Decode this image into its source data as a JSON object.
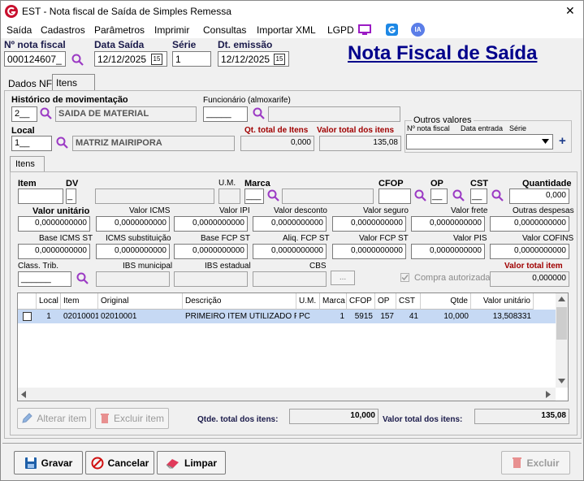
{
  "window": {
    "title": "EST - Nota fiscal de Saída de Simples Remessa",
    "close_glyph": "✕"
  },
  "menu": [
    "Saída",
    "Cadastros",
    "Parâmetros",
    "Imprimir",
    "Consultas",
    "Importar XML",
    "LGPD"
  ],
  "menu_ia": "IA",
  "header": {
    "nota_label": "Nº nota fiscal",
    "nota_value": "000124607_",
    "data_saida_label": "Data Saída",
    "data_saida_value": "12/12/2025",
    "serie_label": "Série",
    "serie_value": "1",
    "dt_emissao_label": "Dt. emissão",
    "dt_emissao_value": "12/12/2025",
    "big_title": "Nota Fiscal de Saída",
    "cal_glyph": "15"
  },
  "tabs": {
    "dados": "Dados NF",
    "itens": "Itens NF"
  },
  "form": {
    "historico_label": "Histórico de movimentação",
    "historico_code": "2__",
    "historico_desc": "SAIDA DE MATERIAL",
    "funcionario_label": "Funcionário (almoxarife)",
    "funcionario_value": "_____",
    "local_label": "Local",
    "local_code": "1__",
    "local_desc": "MATRIZ MAIRIPORA",
    "qt_total_label": "Qt. total de Itens",
    "qt_total_value": "0,000",
    "valor_total_label": "Valor total dos itens",
    "valor_total_value": "135,08",
    "outros_label": "Outros valores",
    "outros_cols": [
      "Nº nota fiscal",
      "Data entrada",
      "Série"
    ],
    "plus": "+"
  },
  "inner_tab": "Itens",
  "item": {
    "item_label": "Item",
    "dv_label": "DV",
    "dv_value": "_",
    "um_label": "U.M.",
    "marca_label": "Marca",
    "marca_value": "___",
    "cfop_label": "CFOP",
    "op_label": "OP",
    "op_value": "__",
    "cst_label": "CST",
    "cst_value": "__",
    "quantidade_label": "Quantidade",
    "quantidade_value": "0,000",
    "row2": [
      {
        "label": "Valor unitário",
        "value": "0,0000000000"
      },
      {
        "label": "Valor ICMS",
        "value": "0,0000000000"
      },
      {
        "label": "Valor IPI",
        "value": "0,0000000000"
      },
      {
        "label": "Valor desconto",
        "value": "0,0000000000"
      },
      {
        "label": "Valor seguro",
        "value": "0,0000000000"
      },
      {
        "label": "Valor frete",
        "value": "0,0000000000"
      },
      {
        "label": "Outras despesas",
        "value": "0,0000000000"
      }
    ],
    "row3": [
      {
        "label": "Base ICMS ST",
        "value": "0,0000000000"
      },
      {
        "label": "ICMS substituição",
        "value": "0,0000000000"
      },
      {
        "label": "Base FCP ST",
        "value": "0,0000000000"
      },
      {
        "label": "Aliq. FCP ST",
        "value": "0,0000000000"
      },
      {
        "label": "Valor FCP ST",
        "value": "0,0000000000"
      },
      {
        "label": "Valor PIS",
        "value": "0,0000000000"
      },
      {
        "label": "Valor COFINS",
        "value": "0,0000000000"
      }
    ],
    "class_trib_label": "Class. Trib.",
    "class_trib_value": "______",
    "ibs_mun_label": "IBS municipal",
    "ibs_est_label": "IBS estadual",
    "cbs_label": "CBS",
    "ellipsis": "...",
    "compra_label": "Compra autorizada",
    "valor_total_item_label": "Valor total item",
    "valor_total_item_value": "0,000000"
  },
  "grid": {
    "columns": [
      "Local",
      "Item",
      "Original",
      "Descrição",
      "U.M.",
      "Marca",
      "CFOP",
      "OP",
      "CST",
      "Qtde",
      "Valor unitário"
    ],
    "row": [
      "1",
      "02010001",
      "02010001",
      "PRIMEIRO ITEM UTILIZADO P...",
      "PC",
      "1",
      "5915",
      "157",
      "41",
      "10,000",
      "13,508331"
    ]
  },
  "bottom": {
    "alterar": "Alterar item",
    "excluir_item": "Excluir item",
    "qtde_total_label": "Qtde. total dos itens:",
    "qtde_total_value": "10,000",
    "valor_total_label": "Valor total dos itens:",
    "valor_total_value": "135,08"
  },
  "actions": {
    "gravar": "Gravar",
    "cancelar": "Cancelar",
    "limpar": "Limpar",
    "excluir": "Excluir"
  },
  "colors": {
    "brand_red": "#c8102e",
    "title_blue": "#00008b",
    "label_red": "#a00000",
    "selected_row": "#c6d9f4"
  }
}
